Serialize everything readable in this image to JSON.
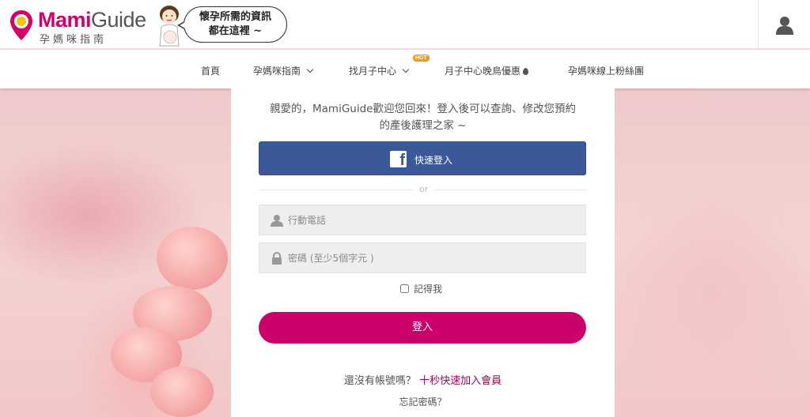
{
  "brand": {
    "name_part1": "Mami",
    "name_part2": "Guide",
    "subtitle": "孕媽咪指南",
    "accent_color": "#d4006b"
  },
  "bubble": {
    "line1": "懷孕所需的資訊",
    "line2": "都在這裡 ~"
  },
  "user_icon": "user-icon",
  "nav": {
    "items": [
      {
        "label": "首頁"
      },
      {
        "label": "孕媽咪指南",
        "dropdown": true
      },
      {
        "label": "找月子中心",
        "dropdown": true,
        "badge": "HOT"
      },
      {
        "label": "月子中心晚鳥優惠",
        "icon": "drop-icon"
      },
      {
        "label": "孕媽咪線上粉絲團"
      }
    ]
  },
  "login": {
    "welcome_line1": "親愛的，MamiGuide歡迎您回來！登入後可以查詢、修改您預約",
    "welcome_line2": "的產後護理之家 ~",
    "facebook_label": "快速登入",
    "facebook_color": "#3b5998",
    "or_text": "or",
    "phone_placeholder": "行動電話",
    "password_placeholder": "密碼 (至少5個字元 )",
    "remember_label": "記得我",
    "login_label": "登入",
    "login_color": "#cc006b",
    "signup_prompt": "還沒有帳號嗎？",
    "signup_link": "十秒快速加入會員",
    "forgot_label": "忘記密碼？"
  }
}
